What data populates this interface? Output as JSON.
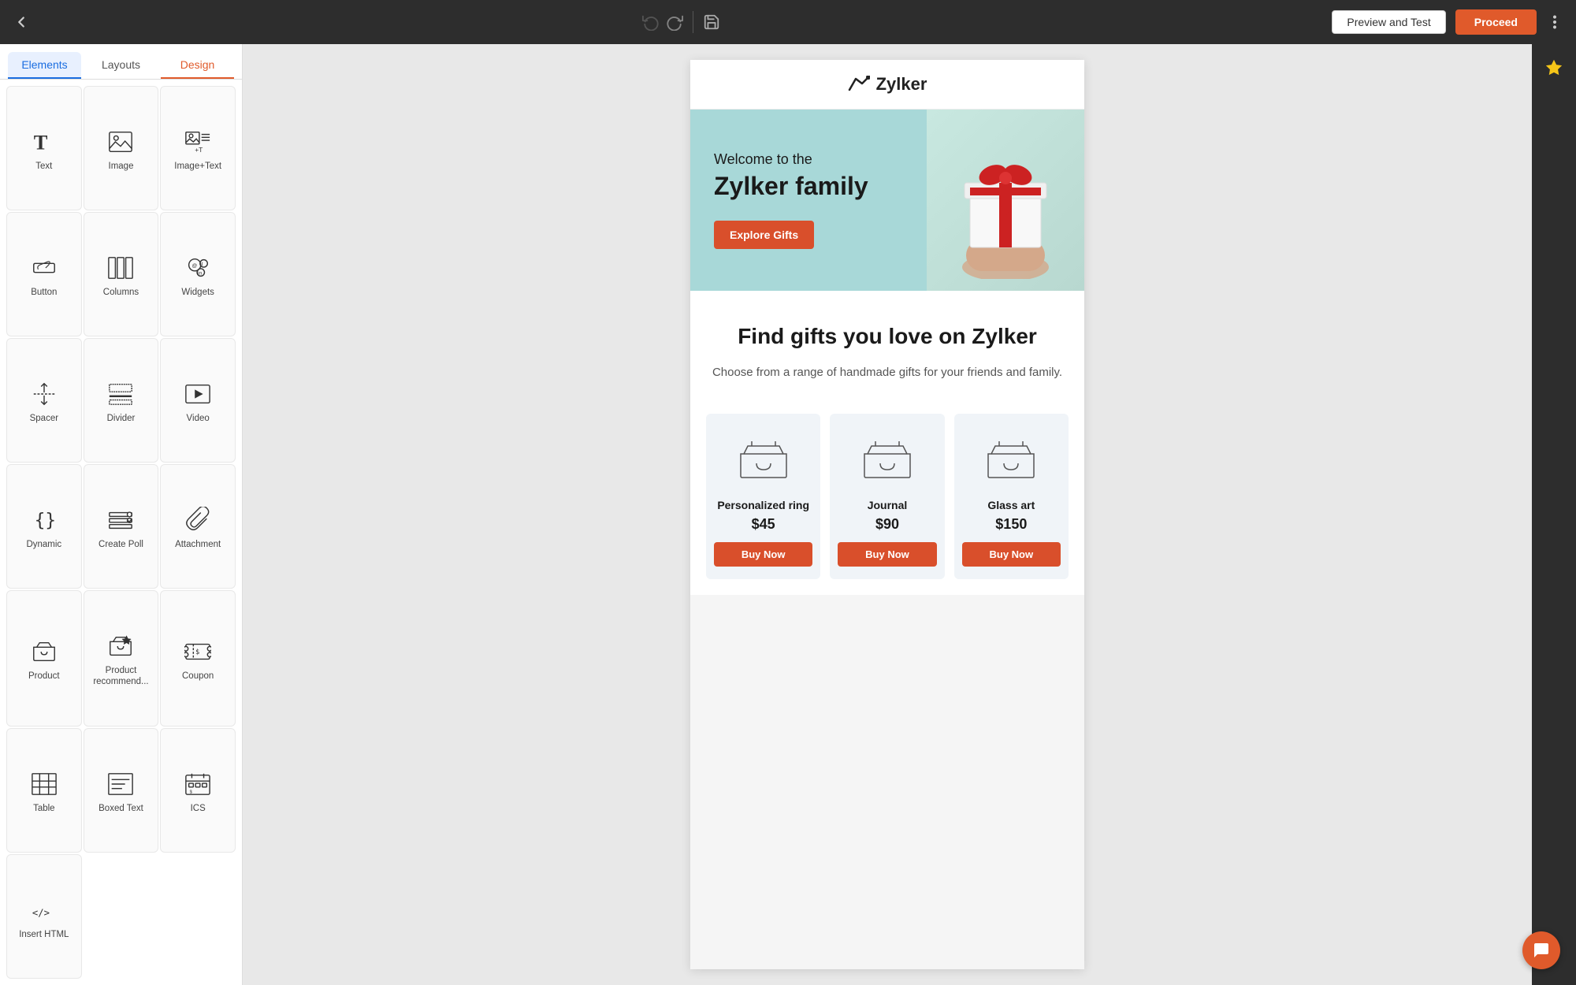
{
  "topbar": {
    "back_icon": "←",
    "undo_icon": "↺",
    "redo_icon": "↻",
    "save_icon": "💾",
    "preview_label": "Preview and Test",
    "proceed_label": "Proceed",
    "more_icon": "⋮"
  },
  "sidebar": {
    "tabs": [
      {
        "id": "elements",
        "label": "Elements",
        "active": "blue"
      },
      {
        "id": "layouts",
        "label": "Layouts",
        "active": ""
      },
      {
        "id": "design",
        "label": "Design",
        "active": "red"
      }
    ],
    "elements": [
      {
        "id": "text",
        "label": "Text",
        "icon": "text"
      },
      {
        "id": "image",
        "label": "Image",
        "icon": "image"
      },
      {
        "id": "image-text",
        "label": "Image+Text",
        "icon": "image-text"
      },
      {
        "id": "button",
        "label": "Button",
        "icon": "button"
      },
      {
        "id": "columns",
        "label": "Columns",
        "icon": "columns"
      },
      {
        "id": "widgets",
        "label": "Widgets",
        "icon": "widgets"
      },
      {
        "id": "spacer",
        "label": "Spacer",
        "icon": "spacer"
      },
      {
        "id": "divider",
        "label": "Divider",
        "icon": "divider"
      },
      {
        "id": "video",
        "label": "Video",
        "icon": "video"
      },
      {
        "id": "dynamic",
        "label": "Dynamic",
        "icon": "dynamic"
      },
      {
        "id": "create-poll",
        "label": "Create Poll",
        "icon": "poll"
      },
      {
        "id": "attachment",
        "label": "Attachment",
        "icon": "attachment"
      },
      {
        "id": "product",
        "label": "Product",
        "icon": "product"
      },
      {
        "id": "product-recommend",
        "label": "Product recommend...",
        "icon": "product-recommend"
      },
      {
        "id": "coupon",
        "label": "Coupon",
        "icon": "coupon"
      },
      {
        "id": "table",
        "label": "Table",
        "icon": "table"
      },
      {
        "id": "boxed-text",
        "label": "Boxed Text",
        "icon": "boxed-text"
      },
      {
        "id": "ics",
        "label": "ICS",
        "icon": "ics"
      },
      {
        "id": "insert-html",
        "label": "Insert HTML",
        "icon": "html"
      }
    ]
  },
  "canvas": {
    "logo_text": "Zylker",
    "hero": {
      "subtitle": "Welcome to the",
      "title": "Zylker family",
      "button_label": "Explore Gifts"
    },
    "section": {
      "title": "Find gifts you love on Zylker",
      "subtitle": "Choose from a range of handmade gifts for your friends and family."
    },
    "products": [
      {
        "name": "Personalized ring",
        "price": "$45",
        "button": "Buy Now"
      },
      {
        "name": "Journal",
        "price": "$90",
        "button": "Buy Now"
      },
      {
        "name": "Glass art",
        "price": "$150",
        "button": "Buy Now"
      }
    ]
  },
  "colors": {
    "accent": "#e05a2b",
    "hero_bg": "#a8d8d8",
    "product_bg": "#f0f4f8",
    "topbar_bg": "#2d2d2d"
  }
}
